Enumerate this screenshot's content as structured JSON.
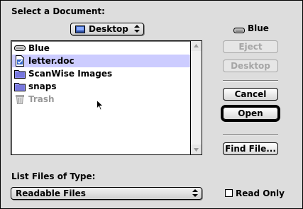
{
  "dialog": {
    "prompt": "Select a Document:",
    "location_popup": {
      "value": "Desktop"
    },
    "volume_label": "Blue",
    "files": [
      {
        "name": "Blue",
        "icon": "hard-disk-icon",
        "selected": false,
        "dim": false
      },
      {
        "name": "letter.doc",
        "icon": "document-icon",
        "selected": true,
        "dim": false
      },
      {
        "name": "ScanWise Images",
        "icon": "folder-icon",
        "selected": false,
        "dim": false
      },
      {
        "name": "snaps",
        "icon": "folder-icon",
        "selected": false,
        "dim": false
      },
      {
        "name": "Trash",
        "icon": "trash-icon",
        "selected": false,
        "dim": true
      }
    ],
    "buttons": {
      "eject": "Eject",
      "desktop": "Desktop",
      "cancel": "Cancel",
      "open": "Open",
      "find_file": "Find File..."
    },
    "file_type_label": "List Files of Type:",
    "file_type_popup": {
      "value": "Readable Files"
    },
    "read_only_label": "Read Only",
    "read_only_checked": false
  },
  "colors": {
    "background": "#dddddd",
    "selection": "#ccccff",
    "disabled_text": "#a6a6a6"
  }
}
